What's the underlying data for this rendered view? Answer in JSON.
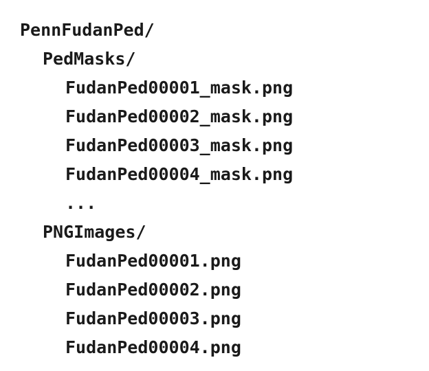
{
  "tree": {
    "root": "PennFudanPed/",
    "masks_dir": {
      "name": "PedMasks/",
      "files": [
        "FudanPed00001_mask.png",
        "FudanPed00002_mask.png",
        "FudanPed00003_mask.png",
        "FudanPed00004_mask.png"
      ],
      "ellipsis": "..."
    },
    "images_dir": {
      "name": "PNGImages/",
      "files": [
        "FudanPed00001.png",
        "FudanPed00002.png",
        "FudanPed00003.png",
        "FudanPed00004.png"
      ]
    }
  }
}
